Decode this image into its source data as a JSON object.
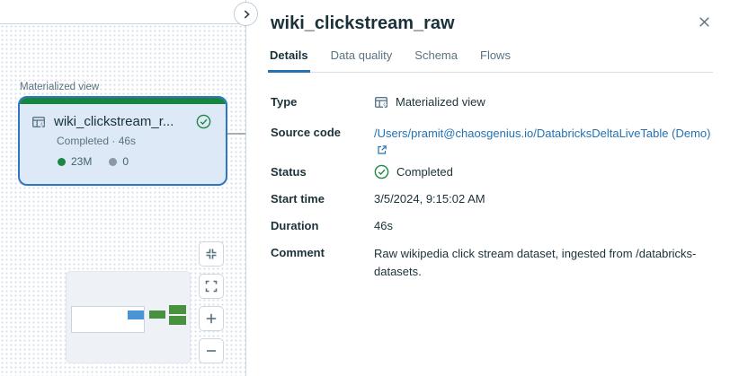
{
  "colors": {
    "accent_blue": "#2272b4",
    "link_blue": "#2272b4",
    "success_green": "#17853f",
    "card_background": "#dde9f7",
    "card_border": "#2d76c4",
    "text_dark": "#1b3139",
    "text_muted": "#5b7282"
  },
  "icons": {
    "expand_panel": "chevron-right-icon",
    "close": "close-icon",
    "type": "materialized-view-icon",
    "status": "check-circle-icon",
    "source_link": "external-link-icon",
    "controls": [
      "compress-icon",
      "fullscreen-icon",
      "zoom-in-icon",
      "zoom-out-icon"
    ]
  },
  "canvas": {
    "node_label": "Materialized view",
    "node": {
      "title": "wiki_clickstream_r...",
      "status": "Completed · 46s",
      "written_count": "23M",
      "dropped_count": "0"
    }
  },
  "panel": {
    "title": "wiki_clickstream_raw",
    "tabs": [
      {
        "label": "Details",
        "active": true
      },
      {
        "label": "Data quality",
        "active": false
      },
      {
        "label": "Schema",
        "active": false
      },
      {
        "label": "Flows",
        "active": false
      }
    ],
    "fields": {
      "type": {
        "label": "Type",
        "value": "Materialized view"
      },
      "source": {
        "label": "Source code",
        "value": "/Users/pramit@chaosgenius.io/DatabricksDeltaLiveTable (Demo)"
      },
      "status": {
        "label": "Status",
        "value": "Completed"
      },
      "start_time": {
        "label": "Start time",
        "value": "3/5/2024, 9:15:02 AM"
      },
      "duration": {
        "label": "Duration",
        "value": "46s"
      },
      "comment": {
        "label": "Comment",
        "value": "Raw wikipedia click stream dataset, ingested from /databricks-datasets."
      }
    }
  }
}
